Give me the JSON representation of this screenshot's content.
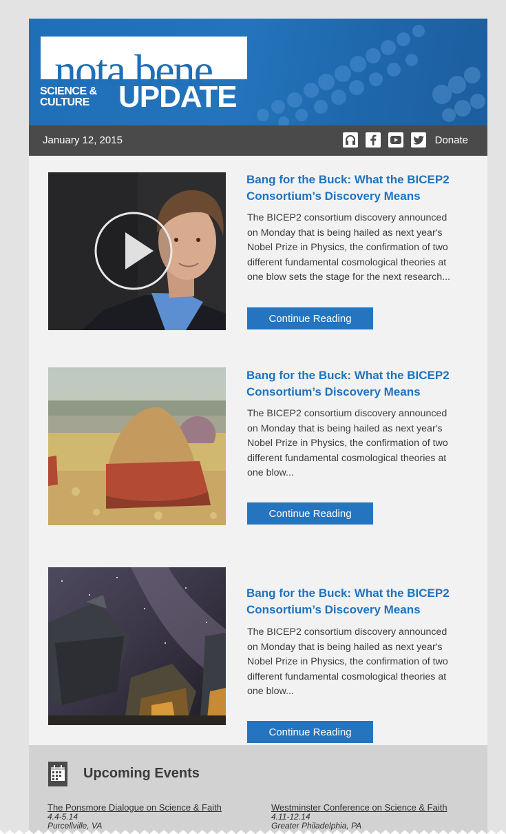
{
  "header": {
    "logo_title": "nota bene",
    "logo_sub_1": "SCIENCE &",
    "logo_sub_2": "CULTURE",
    "logo_update": "UPDATE",
    "date": "January 12, 2015",
    "social_icons": [
      "headphones-icon",
      "facebook-icon",
      "youtube-icon",
      "twitter-icon"
    ],
    "donate_label": "Donate"
  },
  "articles": [
    {
      "title": "Bang for the Buck: What the BICEP2 Consortium’s Discovery Means",
      "body": "The BICEP2 consortium discovery announced on Monday that is being hailed as next year's Nobel Prize in Physics, the confirmation of two different fundamental cosmological theories at one blow sets the stage for the next research...",
      "button": "Continue Reading",
      "image": "video-thumbnail-man-portrait"
    },
    {
      "title": "Bang for the Buck: What the BICEP2 Consortium’s Discovery Means",
      "body": "The BICEP2 consortium discovery announced on Monday that is being hailed as next year's Nobel Prize in Physics, the confirmation of two different fundamental cosmological theories at one blow...",
      "button": "Continue Reading",
      "image": "haystack-painting"
    },
    {
      "title": "Bang for the Buck: What the BICEP2 Consortium’s Discovery Means",
      "body": "The BICEP2 consortium discovery announced on Monday that is being hailed as next year's Nobel Prize in Physics, the confirmation of two different fundamental cosmological theories at one blow...",
      "button": "Continue Reading",
      "image": "telescopes-milky-way"
    }
  ],
  "events": {
    "title": "Upcoming Events",
    "items": [
      {
        "name": "The Ponsmore Dialogue on Science & Faith",
        "date": "4.4-5.14",
        "location": "Purcellville, VA"
      },
      {
        "name": "Westminster Conference on Science & Faith",
        "date": "4.11-12.14",
        "location": "Greater Philadelphia, PA"
      }
    ]
  },
  "colors": {
    "brand_blue": "#1f6fb8",
    "button_blue": "#2474c0",
    "date_bar": "#4a4a4a",
    "events_bg": "#d2d2d2"
  }
}
